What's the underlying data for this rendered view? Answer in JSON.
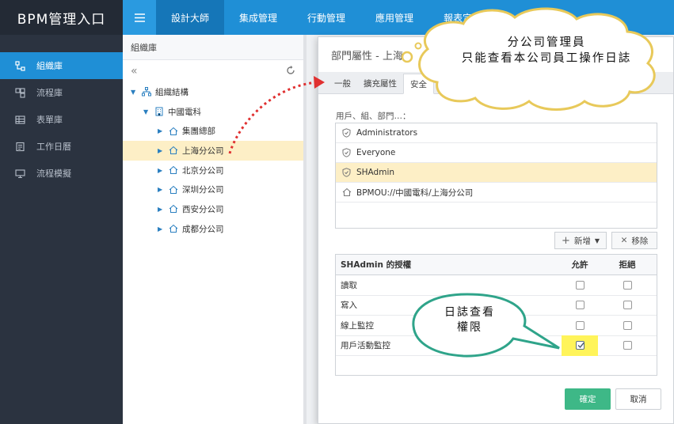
{
  "app": {
    "title": "BPM管理入口"
  },
  "sidebar": {
    "items": [
      {
        "label": "組織庫",
        "icon": "org-icon",
        "active": true
      },
      {
        "label": "流程庫",
        "icon": "process-icon",
        "active": false
      },
      {
        "label": "表單庫",
        "icon": "table-icon",
        "active": false
      },
      {
        "label": "工作日曆",
        "icon": "calendar-icon",
        "active": false
      },
      {
        "label": "流程模擬",
        "icon": "simulate-icon",
        "active": false
      }
    ]
  },
  "topbar": {
    "tabs": [
      {
        "label": "設計大師",
        "active": true
      },
      {
        "label": "集成管理"
      },
      {
        "label": "行動管理"
      },
      {
        "label": "應用管理"
      },
      {
        "label": "報表定制"
      }
    ]
  },
  "tree": {
    "title": "組織庫",
    "root": "組織結構",
    "company": "中國電科",
    "children": [
      "集團總部",
      "上海分公司",
      "北京分公司",
      "深圳分公司",
      "西安分公司",
      "成都分公司"
    ]
  },
  "dialog": {
    "title": "部門屬性 - 上海",
    "tabs": [
      "一般",
      "擴充屬性",
      "安全"
    ],
    "field_label": "用戶、組、部門…：",
    "users": [
      {
        "label": "Administrators",
        "icon": "shield-icon"
      },
      {
        "label": "Everyone",
        "icon": "shield-icon"
      },
      {
        "label": "SHAdmin",
        "icon": "shield-icon"
      },
      {
        "label": "BPMOU://中國電科/上海分公司",
        "icon": "home-icon"
      }
    ],
    "add_label": "新增",
    "remove_label": "移除",
    "perm_header": {
      "name": "SHAdmin 的授權",
      "allow": "允許",
      "deny": "拒絕"
    },
    "perms": [
      {
        "label": "讀取",
        "allow": false,
        "deny": false
      },
      {
        "label": "寫入",
        "allow": false,
        "deny": false
      },
      {
        "label": "線上監控",
        "allow": false,
        "deny": false
      },
      {
        "label": "用戶活動監控",
        "allow": true,
        "deny": false
      }
    ],
    "ok_label": "確定",
    "cancel_label": "取消"
  },
  "annotations": {
    "cloud_line1": "分公司管理員",
    "cloud_line2": "只能查看本公司員工操作日誌",
    "bubble_line1": "日誌查看",
    "bubble_line2": "權限"
  }
}
